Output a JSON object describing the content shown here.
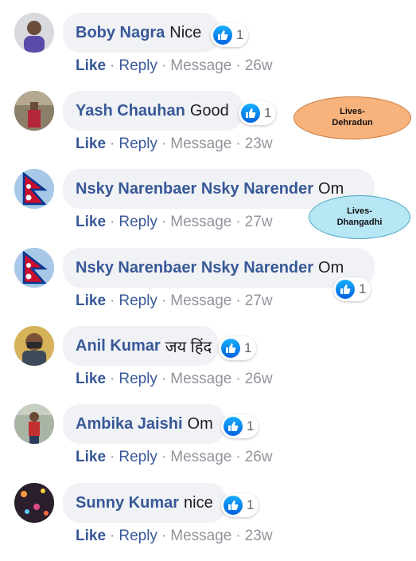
{
  "comments": [
    {
      "author": "Boby Nagra",
      "text": "Nice",
      "reactions": "1",
      "like": "Like",
      "reply": "Reply",
      "message": "Message",
      "time": "26w"
    },
    {
      "author": "Yash Chauhan",
      "text": "Good",
      "reactions": "1",
      "like": "Like",
      "reply": "Reply",
      "message": "Message",
      "time": "23w"
    },
    {
      "author": "Nsky Narenbaer Nsky Narender",
      "text": "Om",
      "reactions": "",
      "like": "Like",
      "reply": "Reply",
      "message": "Message",
      "time": "27w"
    },
    {
      "author": "Nsky Narenbaer Nsky Narender",
      "text": "Om",
      "reactions": "1",
      "like": "Like",
      "reply": "Reply",
      "message": "Message",
      "time": "27w"
    },
    {
      "author": "Anil Kumar",
      "text": "जय हिंद",
      "reactions": "1",
      "like": "Like",
      "reply": "Reply",
      "message": "Message",
      "time": "26w"
    },
    {
      "author": "Ambika Jaishi",
      "text": "Om",
      "reactions": "1",
      "like": "Like",
      "reply": "Reply",
      "message": "Message",
      "time": "26w"
    },
    {
      "author": "Sunny Kumar",
      "text": "nice",
      "reactions": "1",
      "like": "Like",
      "reply": "Reply",
      "message": "Message",
      "time": "23w"
    }
  ],
  "annotations": {
    "dehradun": {
      "line1": "Lives-",
      "line2": "Dehradun"
    },
    "dhangadhi": {
      "line1": "Lives-",
      "line2": "Dhangadhi"
    }
  },
  "colors": {
    "author": "#385898",
    "meta": "#90949c",
    "bubble": "#f0f2f5",
    "like_blue": "#1877f2",
    "tag_orange": "#f8b27c",
    "tag_blue": "#b7e6f5"
  },
  "icons": {
    "reaction": "thumbs-up-icon",
    "flag": "nepal-flag-icon"
  }
}
